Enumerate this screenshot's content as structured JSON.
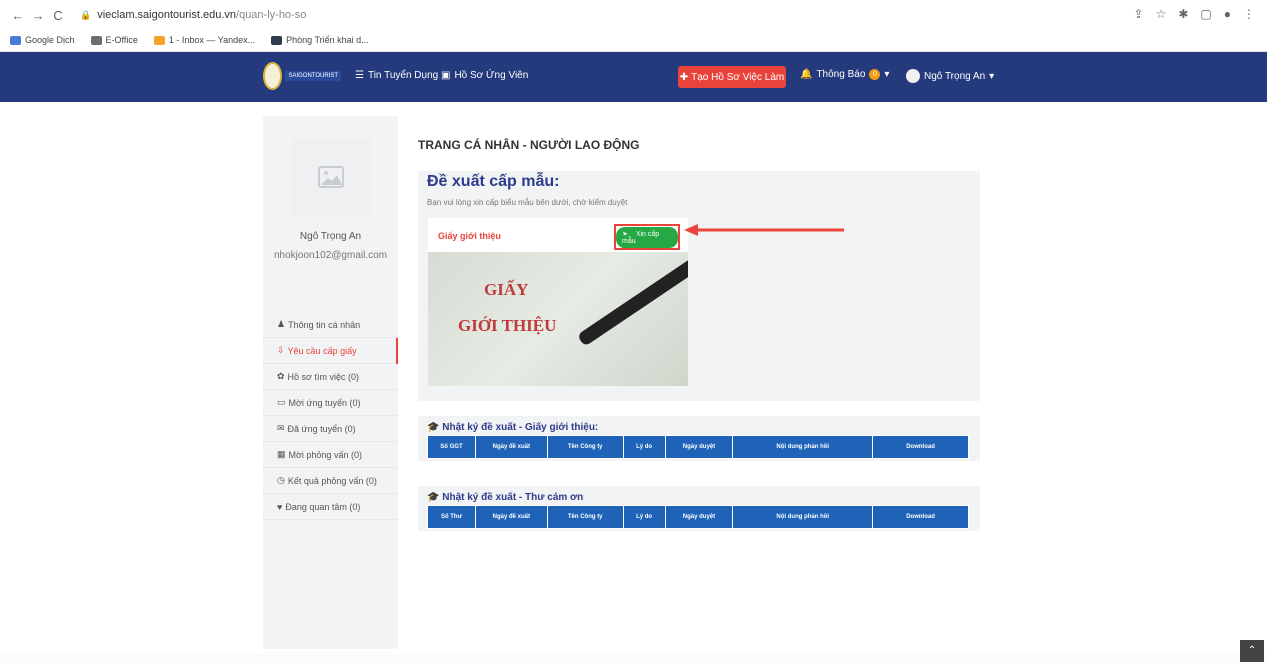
{
  "browser": {
    "url_domain": "vieclam.saigontourist.edu.vn",
    "url_path": "/quan-ly-ho-so",
    "bookmarks": [
      {
        "label": "Google Dịch",
        "color": "#4a7bd8"
      },
      {
        "label": "E-Office",
        "color": "#6d6d6d"
      },
      {
        "label": "1 - Inbox — Yandex...",
        "color": "#f4a22c"
      },
      {
        "label": "Phòng Triển khai d...",
        "color": "#2f3a4d"
      }
    ]
  },
  "sitenav": {
    "logo_text": "SAIGONTOURIST",
    "links": [
      {
        "label": "Tin Tuyển Dụng",
        "icon": "list-icon"
      },
      {
        "label": "Hồ Sơ Ứng Viên",
        "icon": "profile-icon"
      }
    ],
    "cta_label": "Tạo Hồ Sơ Việc Làm",
    "notifications_label": "Thông Báo",
    "notifications_count": "0",
    "user_name": "Ngô Trọng An"
  },
  "profile": {
    "name": "Ngô Trọng An",
    "email": "nhokjoon102@gmail.com"
  },
  "menu": [
    {
      "label": "Thông tin cá nhân",
      "icon": "user-icon",
      "active": false
    },
    {
      "label": "Yêu cầu cấp giấy",
      "icon": "download-icon",
      "active": true
    },
    {
      "label": "Hồ sơ tìm việc (0)",
      "icon": "gear-icon",
      "active": false
    },
    {
      "label": "Mời ứng tuyển (0)",
      "icon": "card-icon",
      "active": false
    },
    {
      "label": "Đã ứng tuyển (0)",
      "icon": "envelope-icon",
      "active": false
    },
    {
      "label": "Mời phỏng vấn (0)",
      "icon": "grid-icon",
      "active": false
    },
    {
      "label": "Kết quả phỏng vấn (0)",
      "icon": "clock-icon",
      "active": false
    },
    {
      "label": "Đang quan tâm (0)",
      "icon": "heart-icon",
      "active": false
    }
  ],
  "main": {
    "title": "TRANG CÁ NHÂN - NGƯỜI LAO ĐỘNG",
    "panel_heading": "Đề xuất cấp mẫu:",
    "panel_subtitle": "Bạn vui lòng xin cấp biểu mẫu bên dưới, chờ kiểm duyệt",
    "card_title": "Giấy giới thiệu",
    "card_button": "Xin cấp mẫu",
    "card_image_line1": "GIẤY",
    "card_image_line2": "GIỚI THIỆU"
  },
  "log1": {
    "heading": "Nhật ký đề xuất - Giấy giới thiệu:",
    "columns": [
      "Số GGT",
      "Ngày đề xuất",
      "Tên Công ty",
      "Lý do",
      "Ngày duyệt",
      "Nội dung phản hồi",
      "Download"
    ]
  },
  "log2": {
    "heading": "Nhật ký đề xuất - Thư cám ơn",
    "columns": [
      "Số Thư",
      "Ngày đề xuất",
      "Tên Công ty",
      "Lý do",
      "Ngày duyệt",
      "Nội dung phản hồi",
      "Download"
    ]
  },
  "colors": {
    "nav_bg": "#243a7c",
    "accent_red": "#e8443b",
    "button_green": "#26a844",
    "table_header": "#1e63b8",
    "heading_blue": "#2d3b8a"
  }
}
